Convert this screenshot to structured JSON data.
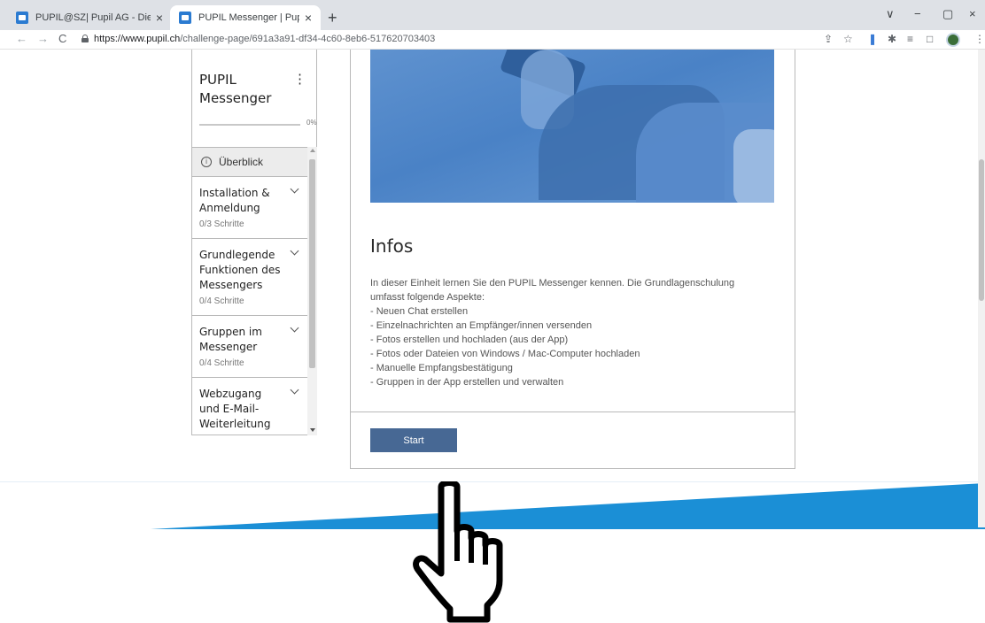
{
  "browser": {
    "tabs": [
      {
        "title": "PUPIL@SZ| Pupil AG - Die eLearn",
        "close": "×"
      },
      {
        "title": "PUPIL Messenger | Pupil AG",
        "close": "×"
      }
    ],
    "new_tab": "+",
    "window_controls": {
      "chevron": "∨",
      "minimize": "−",
      "restore": "▢",
      "close": "×"
    },
    "nav": {
      "back": "←",
      "forward": "→",
      "reload": "C"
    },
    "url_host": "https://www.pupil.ch",
    "url_path": "/challenge-page/691a3a91-df34-4c60-8eb6-517620703403"
  },
  "sidebar": {
    "title_line1": "PUPIL",
    "title_line2": "Messenger",
    "menu_icon": "⋮",
    "progress_label": "0%",
    "progress_value": 0,
    "overview_label": "Überblick",
    "info_icon": "i",
    "sections": [
      {
        "title": "Installation & Anmeldung",
        "steps": "0/3 Schritte"
      },
      {
        "title": "Grundlegende Funktionen des Messengers",
        "steps": "0/4 Schritte"
      },
      {
        "title": "Gruppen im Messenger",
        "steps": "0/4 Schritte"
      },
      {
        "title": "Webzugang und E-Mail-Weiterleitung",
        "steps": ""
      }
    ]
  },
  "main": {
    "heading": "Infos",
    "intro_line1": "In dieser Einheit lernen Sie den PUPIL Messenger kennen. Die Grundlagenschulung",
    "intro_line2": "umfasst folgende Aspekte:",
    "bullets": [
      "- Neuen Chat erstellen",
      "- Einzelnachrichten an Empfänger/innen versenden",
      "- Fotos erstellen und hochladen (aus der App)",
      "- Fotos oder Dateien von Windows / Mac-Computer hochladen",
      "- Manuelle Empfangsbestätigung",
      "- Gruppen in der App erstellen und verwalten"
    ],
    "start_label": "Start"
  },
  "colors": {
    "accent": "#476894",
    "footer_wave": "#1b8fd6",
    "hero": "#4a82c6"
  }
}
